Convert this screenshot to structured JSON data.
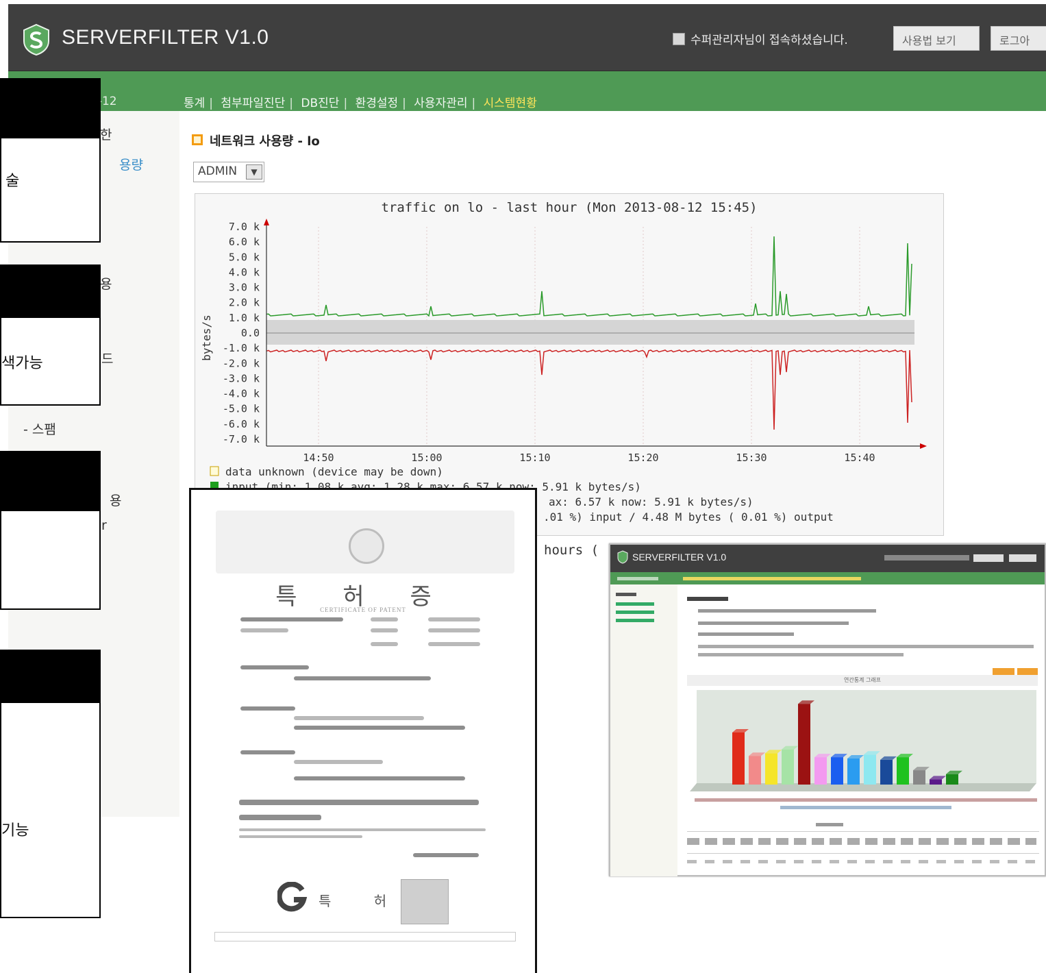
{
  "header": {
    "app_title": "SERVERFILTER V1.0",
    "welcome": "수퍼관리자님이 접속하셨습니다.",
    "manual_button": "사용법 보기",
    "logout_button": "로그아"
  },
  "nav": {
    "date": "0-12",
    "items": [
      "통계",
      "첨부파일진단",
      "DB진단",
      "환경설정",
      "사용자관리",
      "시스템현황"
    ],
    "active_index": 5
  },
  "sidebar_fragments": [
    "한",
    "용량",
    "용",
    "드",
    "- 스팸",
    "용",
    "r"
  ],
  "content": {
    "title": "네트워크 사용량 - lo",
    "select_value": "ADMIN"
  },
  "graph": {
    "title": "traffic on lo - last hour (Mon 2013-08-12 15:45)",
    "ylabel": "bytes/s",
    "y_ticks": [
      "7.0 k",
      "6.0 k",
      "5.0 k",
      "4.0 k",
      "3.0 k",
      "2.0 k",
      "1.0 k",
      "0.0",
      "-1.0 k",
      "-2.0 k",
      "-3.0 k",
      "-4.0 k",
      "-5.0 k",
      "-6.0 k",
      "-7.0 k"
    ],
    "x_ticks": [
      "14:50",
      "15:00",
      "15:10",
      "15:20",
      "15:30",
      "15:40"
    ],
    "legend_unknown": "data unknown (device may be down)",
    "legend_input": "input   (min:   1.08 k  avg:   1.28 k  max:   6.57 k   now:   5.91 k bytes/s)",
    "legend_output": "ax:   6.57 k   now:   5.91 k bytes/s)",
    "legend_total": ".01 %) input   /   4.48 M bytes   ( 0.01 %) output",
    "colors": {
      "input": "#2a9a2a",
      "output": "#cc2222",
      "band": "#d5d5d5"
    }
  },
  "graph2_caption": "hours (",
  "callouts": [
    {
      "text": "술"
    },
    {
      "text": "색가능"
    },
    {
      "text": ""
    },
    {
      "text": "기능"
    }
  ],
  "certificate": {
    "title": "특 허 증",
    "subtitle": "CERTIFICATE OF PATENT",
    "office": "특 허 청"
  },
  "mini_screenshot": {
    "app_title": "SERVERFILTER V1.0",
    "chart_title": "연간통계 그래프"
  }
}
